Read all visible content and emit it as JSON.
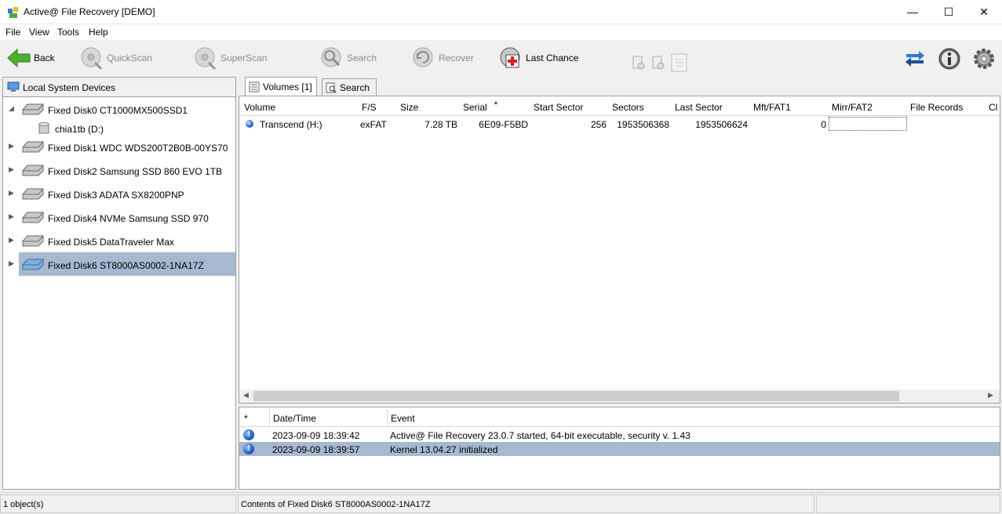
{
  "window": {
    "title": "Active@ File Recovery [DEMO]",
    "minimize": "—",
    "maximize": "☐",
    "close": "✕"
  },
  "menu": [
    "File",
    "View",
    "Tools",
    "Help"
  ],
  "toolbar": {
    "back": "Back",
    "quickscan": "QuickScan",
    "superscan": "SuperScan",
    "search": "Search",
    "recover": "Recover",
    "last_chance": "Last Chance"
  },
  "left_panel": {
    "header": "Local System Devices",
    "disks": [
      {
        "label": "Fixed Disk0 CT1000MX500SSD1",
        "expanded": true
      },
      {
        "label": "Fixed Disk1 WDC WDS200T2B0B-00YS70",
        "expanded": false
      },
      {
        "label": "Fixed Disk2 Samsung SSD 860 EVO 1TB",
        "expanded": false
      },
      {
        "label": "Fixed Disk3 ADATA SX8200PNP",
        "expanded": false
      },
      {
        "label": "Fixed Disk4 NVMe Samsung SSD 970",
        "expanded": false
      },
      {
        "label": "Fixed Disk5 DataTraveler Max",
        "expanded": false
      },
      {
        "label": "Fixed Disk6 ST8000AS0002-1NA17Z",
        "expanded": false,
        "selected": true
      }
    ],
    "child_volume": "chia1tb (D:)"
  },
  "tabs": {
    "volumes": "Volumes [1]",
    "search": "Search"
  },
  "volumes_table": {
    "columns": [
      "Volume",
      "F/S",
      "Size",
      "Serial",
      "Start Sector",
      "Sectors",
      "Last Sector",
      "Mft/FAT1",
      "Mirr/FAT2",
      "File Records",
      "Cl"
    ],
    "rows": [
      {
        "volume": "Transcend (H:)",
        "fs": "exFAT",
        "size": "7.28 TB",
        "serial": "6E09-F5BD",
        "start_sector": "256",
        "sectors": "1953506368",
        "last_sector": "1953506624",
        "mft_fat1": "0",
        "mirr_fat2": "",
        "file_records": ""
      }
    ]
  },
  "log": {
    "columns": [
      "*",
      "Date/Time",
      "Event"
    ],
    "rows": [
      {
        "datetime": "2023-09-09 18:39:42",
        "event": "Active@ File Recovery 23.0.7 started, 64-bit executable, security v. 1.43"
      },
      {
        "datetime": "2023-09-09 18:39:57",
        "event": "Kernel 13.04.27 initialized",
        "selected": true
      }
    ]
  },
  "status": {
    "objects": "1 object(s)",
    "contents": "Contents of Fixed Disk6 ST8000AS0002-1NA17Z",
    "extra": ""
  }
}
